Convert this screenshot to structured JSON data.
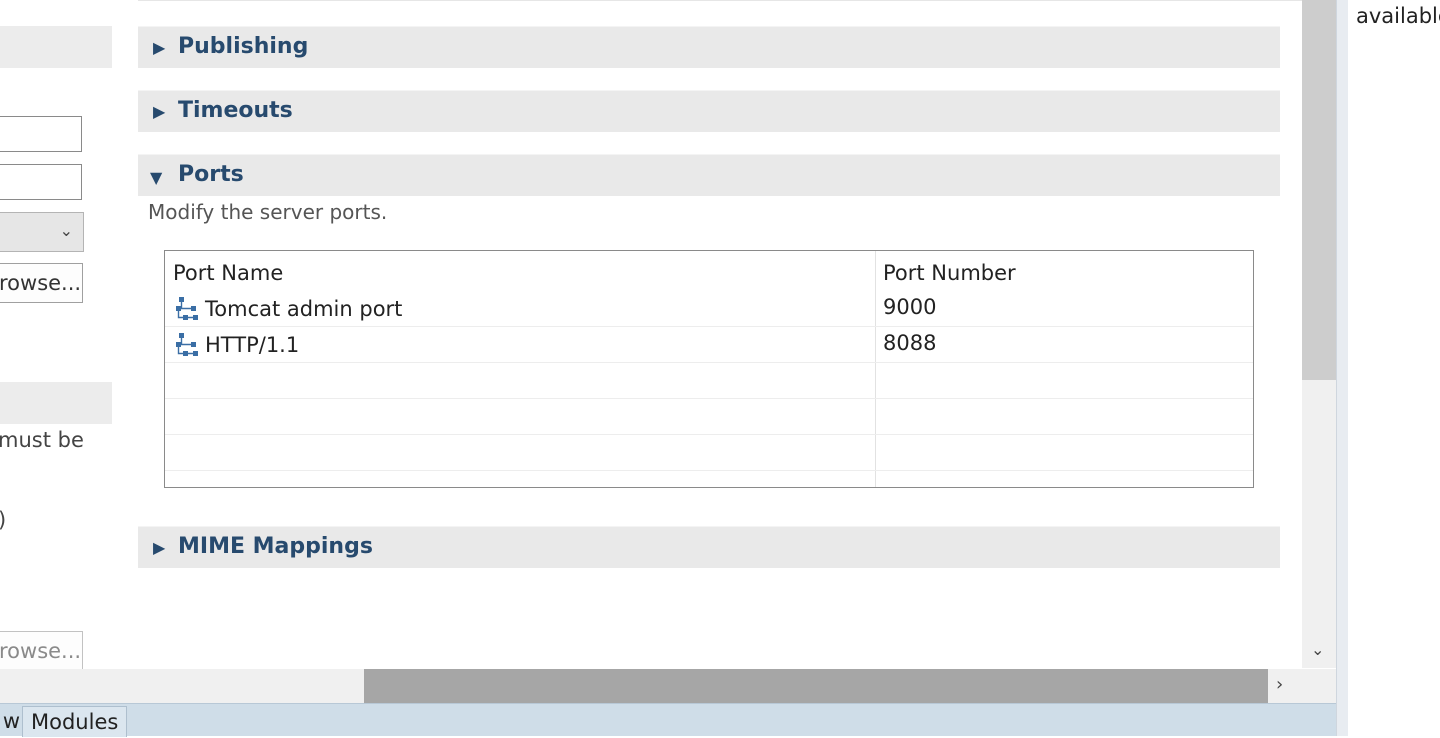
{
  "left_panel": {
    "browse_label": "rowse...",
    "browse_disabled_label": "rowse...",
    "text_must_be": "must be",
    "text_paren": ")"
  },
  "sections": {
    "publishing": {
      "title": "Publishing",
      "expanded": false
    },
    "timeouts": {
      "title": "Timeouts",
      "expanded": false
    },
    "ports": {
      "title": "Ports",
      "expanded": true,
      "description": "Modify the server ports.",
      "columns": [
        "Port Name",
        "Port Number"
      ],
      "rows": [
        {
          "name": "Tomcat admin port",
          "number": "9000",
          "icon": "port-icon"
        },
        {
          "name": "HTTP/1.1",
          "number": "8088",
          "icon": "port-icon"
        }
      ]
    },
    "mime": {
      "title": "MIME Mappings",
      "expanded": false
    }
  },
  "tabs": {
    "overview_partial": "w",
    "modules": "Modules"
  },
  "right_panel": {
    "text": "available"
  },
  "colors": {
    "section_title": "#274a6e",
    "section_bg": "#e9e9e9",
    "tabbar_bg": "#cfdde8"
  }
}
